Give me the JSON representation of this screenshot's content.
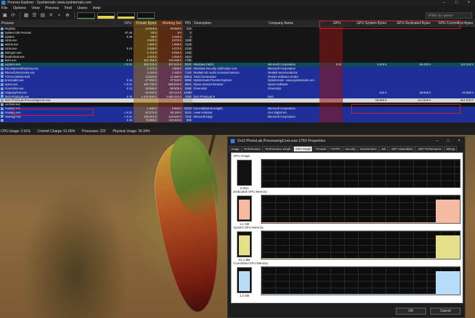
{
  "pe": {
    "title": "Process Explorer - Sysinternals: www.sysinternals.com",
    "menu": [
      "File",
      "Options",
      "View",
      "Process",
      "Find",
      "Users",
      "Help"
    ],
    "filter_placeholder": "<Filter by name>",
    "columns": [
      "Process",
      "CPU",
      "Private Bytes",
      "Working Set",
      "PID",
      "Description",
      "Company Name",
      "GPU",
      "GPU System Bytes",
      "GPU Dedicated Bytes",
      "GPU Committed Bytes"
    ],
    "rows": [
      {
        "style": "plain",
        "name": "Registry",
        "cpu": "",
        "priv": "14 016 K",
        "ws": "29 888 K",
        "pid": "224",
        "desc": "",
        "comp": "",
        "gpu": "",
        "gsys": "",
        "gded": "",
        "gcom": ""
      },
      {
        "style": "plain",
        "name": "System Idle Process",
        "cpu": "97.45",
        "priv": "60 K",
        "ws": "8 K",
        "pid": "0",
        "desc": "",
        "comp": "",
        "gpu": "",
        "gsys": "",
        "gded": "",
        "gcom": ""
      },
      {
        "style": "plain",
        "name": "System",
        "cpu": "0.38",
        "priv": "56 K",
        "ws": "3 240 K",
        "pid": "4",
        "desc": "",
        "comp": "",
        "gpu": "",
        "gsys": "",
        "gded": "",
        "gcom": ""
      },
      {
        "style": "plain",
        "name": "csrss.exe",
        "cpu": "",
        "priv": "2 500 K",
        "ws": "3 676 K",
        "pid": "1108",
        "desc": "",
        "comp": "",
        "gpu": "",
        "gsys": "",
        "gded": "",
        "gcom": ""
      },
      {
        "style": "plain",
        "name": "wininit.exe",
        "cpu": "",
        "priv": "1 560 K",
        "ws": "1 996 K",
        "pid": "1228",
        "desc": "",
        "comp": "",
        "gpu": "",
        "gsys": "",
        "gded": "",
        "gcom": ""
      },
      {
        "style": "plain",
        "name": "csrss.exe",
        "cpu": "0.13",
        "priv": "2 888 K",
        "ws": "4 072 K",
        "pid": "1236",
        "desc": "",
        "comp": "",
        "gpu": "",
        "gsys": "",
        "gded": "",
        "gcom": ""
      },
      {
        "style": "plain",
        "name": "winlogon.exe",
        "cpu": "",
        "priv": "2 724 K",
        "ws": "8 056 K",
        "pid": "1336",
        "desc": "",
        "comp": "",
        "gpu": "",
        "gsys": "",
        "gded": "",
        "gcom": ""
      },
      {
        "style": "plain",
        "name": "fontdrvhost.exe",
        "cpu": "",
        "priv": "4 416 K",
        "ws": "4 256 K",
        "pid": "1624",
        "desc": "",
        "comp": "",
        "gpu": "",
        "gsys": "",
        "gded": "",
        "gcom": ""
      },
      {
        "style": "plain",
        "name": "dwm.exe",
        "cpu": "0.13",
        "priv": "331 368 K",
        "ws": "145 696 K",
        "pid": "1780",
        "desc": "",
        "comp": "",
        "gpu": "",
        "gsys": "",
        "gded": "",
        "gcom": ""
      },
      {
        "style": "teal",
        "name": "explorer.exe",
        "cpu": "< 0.01",
        "priv": "282 232 K",
        "ws": "307 820 K",
        "pid": "5320",
        "desc": "Windows Intézô",
        "comp": "Microsoft Corporation",
        "gpu": "0.02",
        "gsys": "3 416 K",
        "gded": "56 432 K",
        "gcom": "123 104 K"
      },
      {
        "style": "blue",
        "name": "SecurityHealthSystray.exe",
        "cpu": "",
        "priv": "2 172 K",
        "ws": "4 808 K",
        "pid": "8180",
        "desc": "Windows Security notification icon",
        "comp": "Microsoft Corporation",
        "gpu": "",
        "gsys": "",
        "gded": "",
        "gcom": ""
      },
      {
        "style": "blue",
        "name": "RtkAudUService64.exe",
        "cpu": "",
        "priv": "3 424 K",
        "ws": "4 160 K",
        "pid": "7140",
        "desc": "Realtek HD Audio Universal Service",
        "comp": "Realtek Semiconductor",
        "gpu": "",
        "gsys": "",
        "gded": "",
        "gcom": ""
      },
      {
        "style": "blue",
        "name": "TOTALCMD64.EXE",
        "cpu": "",
        "priv": "13 824 K",
        "ws": "21 680 K",
        "pid": "15916",
        "desc": "Total Commander",
        "comp": "Ghisler Software GmbH",
        "gpu": "",
        "gsys": "",
        "gded": "",
        "gcom": ""
      },
      {
        "style": "blue",
        "name": "procexp64.exe",
        "cpu": "0.13",
        "priv": "47 864 K",
        "ws": "47 528 K",
        "pid": "5996",
        "desc": "Sysinternals Process Explorer",
        "comp": "Sysinternals - www.sysinternals.com",
        "gpu": "",
        "gsys": "",
        "gded": "",
        "gcom": ""
      },
      {
        "style": "blue",
        "name": "opera.exe",
        "cpu": "< 0.01",
        "priv": "362 700 K",
        "ws": "590 536 K",
        "pid": "6504",
        "desc": "Opera Internet Browser",
        "comp": "Opera Software",
        "gpu": "",
        "gsys": "",
        "gded": "",
        "gcom": ""
      },
      {
        "style": "blue",
        "name": "Greenshot.exe",
        "cpu": "0.13",
        "priv": "50 856 K",
        "ws": "88 508 K",
        "pid": "5388",
        "desc": "Greenshot",
        "comp": "Greenshot",
        "gpu": "",
        "gsys": "",
        "gded": "",
        "gcom": ""
      },
      {
        "style": "blue",
        "name": "SnippingTool.exe",
        "cpu": "",
        "priv": "65 932 K",
        "ws": "110 212 K",
        "pid": "16480",
        "desc": "",
        "comp": "",
        "gpu": "",
        "gsys": "432 K",
        "gded": "38 836 K",
        "gcom": "43 088 K"
      },
      {
        "style": "blue",
        "name": "DxO.PhotoLab.exe",
        "cpu": "0.76",
        "priv": "4 479 500 K",
        "ws": "2 500 424 K",
        "pid": "7020",
        "desc": "DxO PhotoLab 9",
        "comp": "DxO",
        "gpu": "",
        "gsys": "",
        "gded": "",
        "gcom": ""
      },
      {
        "style": "sel",
        "name": "DxO.PhotoLab.ProcessingCore.exe",
        "cpu": "",
        "priv": "",
        "ws": "",
        "pid": "",
        "desc": "",
        "comp": "",
        "gpu": "",
        "gsys": "55 856 K",
        "gded": "414 520 K",
        "gcom": "541 632 K"
      },
      {
        "style": "plain",
        "name": "conhost.exe",
        "cpu": "",
        "priv": "",
        "ws": "",
        "pid": "",
        "desc": "",
        "comp": "",
        "gpu": "",
        "gsys": "",
        "gded": "",
        "gcom": ""
      },
      {
        "style": "blue",
        "name": "AvastUI.exe",
        "cpu": "",
        "priv": "1 840 K",
        "ws": "9 856 K",
        "pid": "15032",
        "desc": "Konzolablak-kiszolgáló",
        "comp": "Microsoft Corporation",
        "gpu": "",
        "gsys": "",
        "gded": "",
        "gcom": ""
      },
      {
        "style": "blue",
        "name": "msedge.exe",
        "cpu": "< 0.01",
        "priv": "40 276 K",
        "ws": "58 196 K",
        "pid": "9104",
        "desc": "Avast Antivirus",
        "comp": "Gen Digital Inc.",
        "gpu": "",
        "gsys": "",
        "gded": "",
        "gcom": ""
      },
      {
        "style": "blue",
        "name": "Taskmgr.exe",
        "cpu": "< 0.01",
        "priv": "105 524 K",
        "ws": "126 692 K",
        "pid": "7532",
        "desc": "Microsoft Edge",
        "comp": "Microsoft Corporation",
        "gpu": "",
        "gsys": "",
        "gded": "",
        "gcom": ""
      },
      {
        "style": "blue",
        "name": "",
        "cpu": "0.25",
        "priv": "75 880 K",
        "ws": "143 404 K",
        "pid": "936",
        "desc": "",
        "comp": "",
        "gpu": "",
        "gsys": "",
        "gded": "",
        "gcom": ""
      }
    ],
    "status": {
      "cpu": "CPU Usage: 2.91%",
      "commit": "Commit Charge: 51.06%",
      "processes": "Processes: 222",
      "physical": "Physical Usage: 35.34%"
    }
  },
  "dialog": {
    "title": "DxO.PhotoLab.ProcessingCore.exe:1752 Properties",
    "tabs": [
      "Image",
      "Performance",
      "Performance Graph",
      "GPU Graph",
      "Threads",
      "TCP/IP",
      "Security",
      "Environment",
      "Job",
      ".NET Assemblies",
      ".NET Performance",
      "Strings"
    ],
    "active_tab": "GPU Graph",
    "sections": [
      {
        "label": "GPU Usage",
        "value": "0.00%",
        "level": 0.0,
        "color": "#4caf50"
      },
      {
        "label": "Dedicated GPU Memory",
        "value": "1.1 GB",
        "level": 0.85,
        "color": "#f6b9a2"
      },
      {
        "label": "System GPU Memory",
        "value": "64.1 MB",
        "level": 0.85,
        "color": "#e4e08a"
      },
      {
        "label": "Committed GPU Memory",
        "value": "1.2 GB",
        "level": 0.85,
        "color": "#b7dcf7"
      }
    ],
    "ok": "OK",
    "cancel": "Cancel"
  }
}
